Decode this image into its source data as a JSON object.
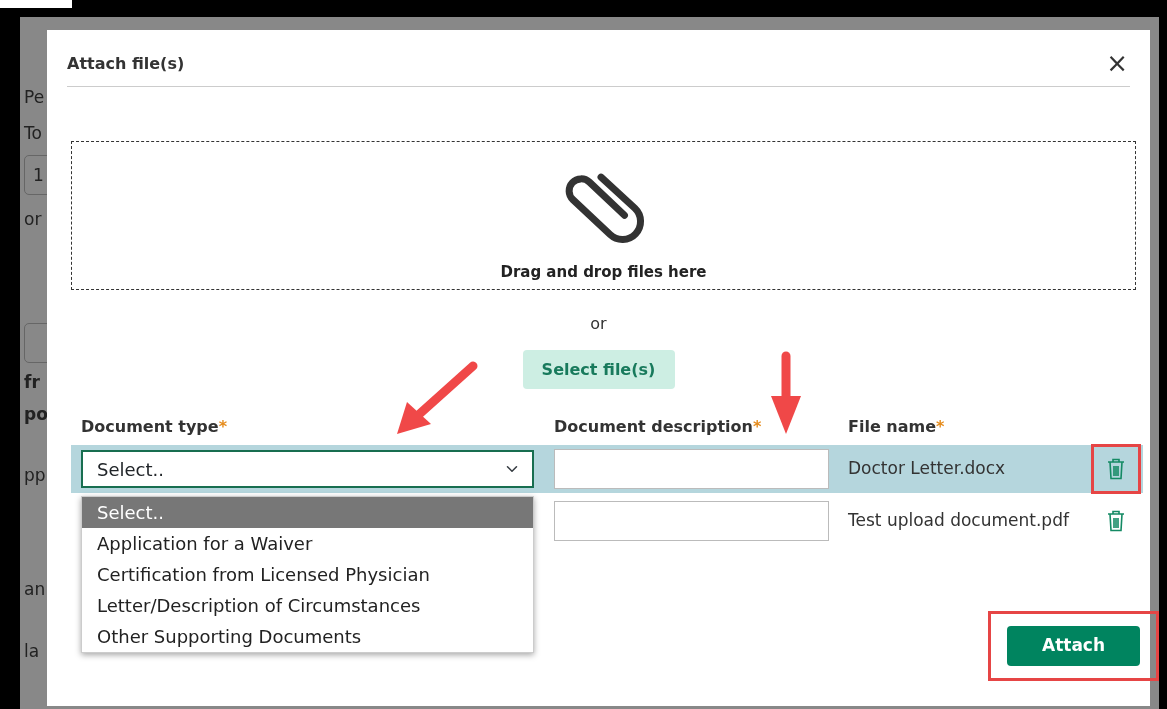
{
  "background_page": [
    {
      "kind": "text",
      "text": "Pe"
    },
    {
      "kind": "text",
      "text": "To"
    },
    {
      "kind": "field",
      "text": "1"
    },
    {
      "kind": "text",
      "text": "or"
    },
    {
      "kind": "field"
    },
    {
      "kind": "bold",
      "text": "fr"
    },
    {
      "kind": "bold",
      "text": "po"
    },
    {
      "kind": "text",
      "text": "pp"
    },
    {
      "kind": "text",
      "text": "an"
    },
    {
      "kind": "text",
      "text": "la"
    }
  ],
  "dialog": {
    "title": "Attach file(s)",
    "close": "×",
    "dropzone": {
      "text": "Drag and drop files here"
    },
    "or_text": "or",
    "select_button": "Select file(s)",
    "columns": [
      {
        "label": "Document type",
        "required_mark": "*"
      },
      {
        "label": "Document description",
        "required_mark": "*"
      },
      {
        "label": "File name",
        "required_mark": "*"
      }
    ],
    "files": [
      {
        "document_type": "Select..",
        "file_name": "Doctor Letter.docx",
        "selected": true,
        "highlighted": true
      },
      {
        "file_name": "Test upload document.pdf",
        "selected": false,
        "highlighted": false
      }
    ],
    "dropdown_options": [
      {
        "label": "Select..",
        "selected": true
      },
      {
        "label": "Application for a Waiver",
        "selected": false
      },
      {
        "label": "Certification from Licensed Physician",
        "selected": false
      },
      {
        "label": "Letter/Description of Circumstances",
        "selected": false
      },
      {
        "label": "Other Supporting Documents",
        "selected": false
      }
    ],
    "attach_button": {
      "label": "Attach",
      "highlighted": true
    }
  }
}
